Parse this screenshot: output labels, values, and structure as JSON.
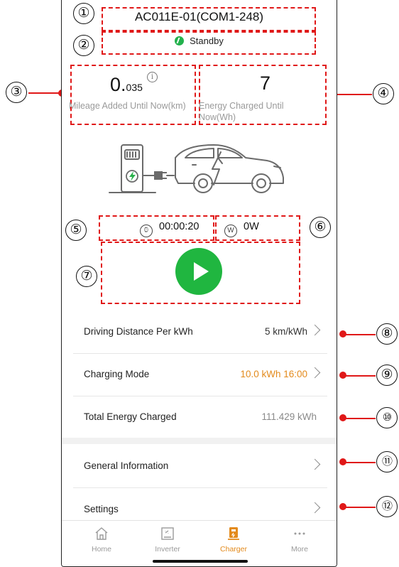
{
  "device": {
    "title": "AC011E-01(COM1-248)",
    "status": "Standby"
  },
  "metrics": {
    "mileage": {
      "value_main": "0.",
      "value_small": "035",
      "info": "i",
      "label": "Mileage Added Until Now(km)"
    },
    "energy": {
      "value": "7",
      "label_line1": "Energy Charged Until",
      "label_line2": "Now(Wh)"
    }
  },
  "timer": {
    "duration": "00:00:20",
    "power": "0W",
    "power_icon_letter": "W"
  },
  "settings_rows": [
    {
      "label": "Driving Distance Per kWh",
      "value": "5 km/kWh"
    },
    {
      "label": "Charging Mode",
      "value": "10.0 kWh 16:00"
    },
    {
      "label": "Total Energy Charged",
      "value": "111.429 kWh"
    },
    {
      "label": "General Information",
      "value": ""
    },
    {
      "label": "Settings",
      "value": ""
    }
  ],
  "tabs": [
    {
      "label": "Home",
      "icon": "home-icon"
    },
    {
      "label": "Inverter",
      "icon": "inverter-icon"
    },
    {
      "label": "Charger",
      "icon": "charger-icon"
    },
    {
      "label": "More",
      "icon": "more-icon"
    }
  ],
  "markers": [
    "①",
    "②",
    "③",
    "④",
    "⑤",
    "⑥",
    "⑦",
    "⑧",
    "⑨",
    "⑩",
    "⑪",
    "⑫"
  ],
  "colors": {
    "accent": "#e38a1c",
    "play_green": "#20b640",
    "annotation_red": "#e01818"
  }
}
